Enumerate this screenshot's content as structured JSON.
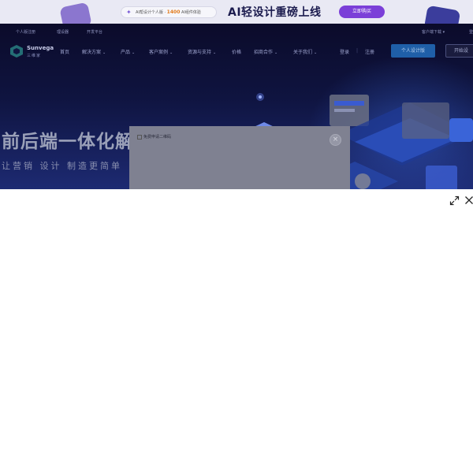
{
  "promo": {
    "pill_prefix": "AI帮设计个人版 ·",
    "pill_highlight": "1400",
    "pill_suffix": "AI组件体验",
    "headline": "AI轻设计重磅上线",
    "cta": "立即购买"
  },
  "topbar": {
    "left_items": [
      "个人版注册",
      "理设器",
      "开发平台"
    ],
    "right_items": [
      "客户端下载 ▾",
      "登"
    ]
  },
  "logo": {
    "name": "Sunvega",
    "sub": "三维家"
  },
  "nav": {
    "items": [
      {
        "label": "首页",
        "has_chevron": false
      },
      {
        "label": "解决方案",
        "has_chevron": true
      },
      {
        "label": "产品",
        "has_chevron": true
      },
      {
        "label": "客户案例",
        "has_chevron": true
      },
      {
        "label": "资源与支持",
        "has_chevron": true
      },
      {
        "label": "价格",
        "has_chevron": false
      },
      {
        "label": "招商合作",
        "has_chevron": true
      },
      {
        "label": "关于我们",
        "has_chevron": true
      }
    ],
    "login": "登录",
    "separator": "|",
    "register": "注册",
    "plan_button": "个人设计版",
    "start_button": "开始设"
  },
  "hero": {
    "title": "前后端一体化解",
    "subtitle": "让营销 设计 制造更简单"
  },
  "modal": {
    "image_alt": "免费申请二维码",
    "close_glyph": "×"
  },
  "colors": {
    "promo_cta": "#7b3fd8",
    "plan_button": "#1f5fa8",
    "hero_bg": "#0f1440"
  }
}
